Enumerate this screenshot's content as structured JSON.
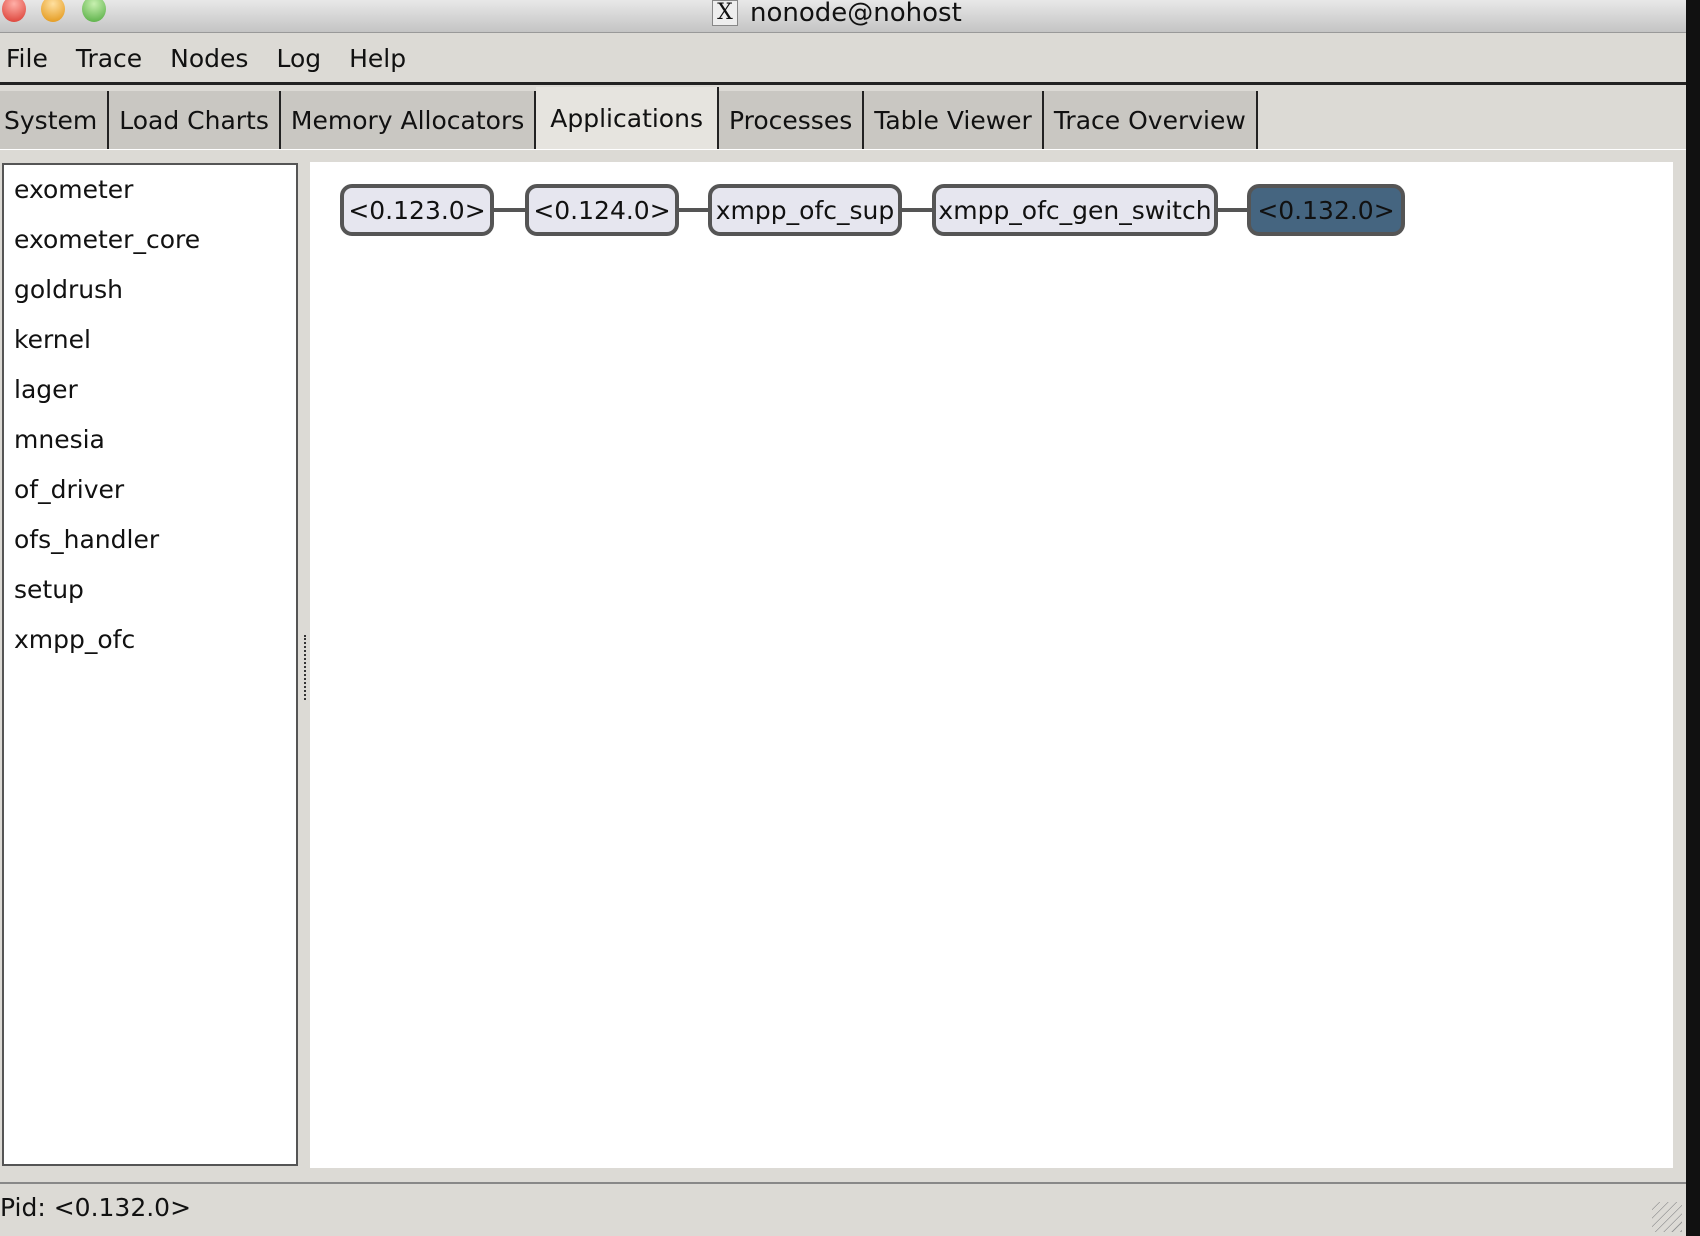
{
  "window": {
    "title": "nonode@nohost",
    "x_icon": "x11-icon"
  },
  "menu": [
    "File",
    "Trace",
    "Nodes",
    "Log",
    "Help"
  ],
  "tabs": [
    {
      "label": "System"
    },
    {
      "label": "Load Charts"
    },
    {
      "label": "Memory Allocators"
    },
    {
      "label": "Applications",
      "active": true
    },
    {
      "label": "Processes"
    },
    {
      "label": "Table Viewer"
    },
    {
      "label": "Trace Overview"
    }
  ],
  "applications": [
    "exometer",
    "exometer_core",
    "goldrush",
    "kernel",
    "lager",
    "mnesia",
    "of_driver",
    "ofs_handler",
    "setup",
    "xmpp_ofc"
  ],
  "tree": {
    "nodes": [
      "<0.123.0>",
      "<0.124.0>",
      "xmpp_ofc_sup",
      "xmpp_ofc_gen_switch",
      "<0.132.0>"
    ],
    "selected": "<0.132.0>",
    "selected_color": "#456580",
    "node_color": "#e6e6ef"
  },
  "status": {
    "text": "Pid: <0.132.0>"
  }
}
